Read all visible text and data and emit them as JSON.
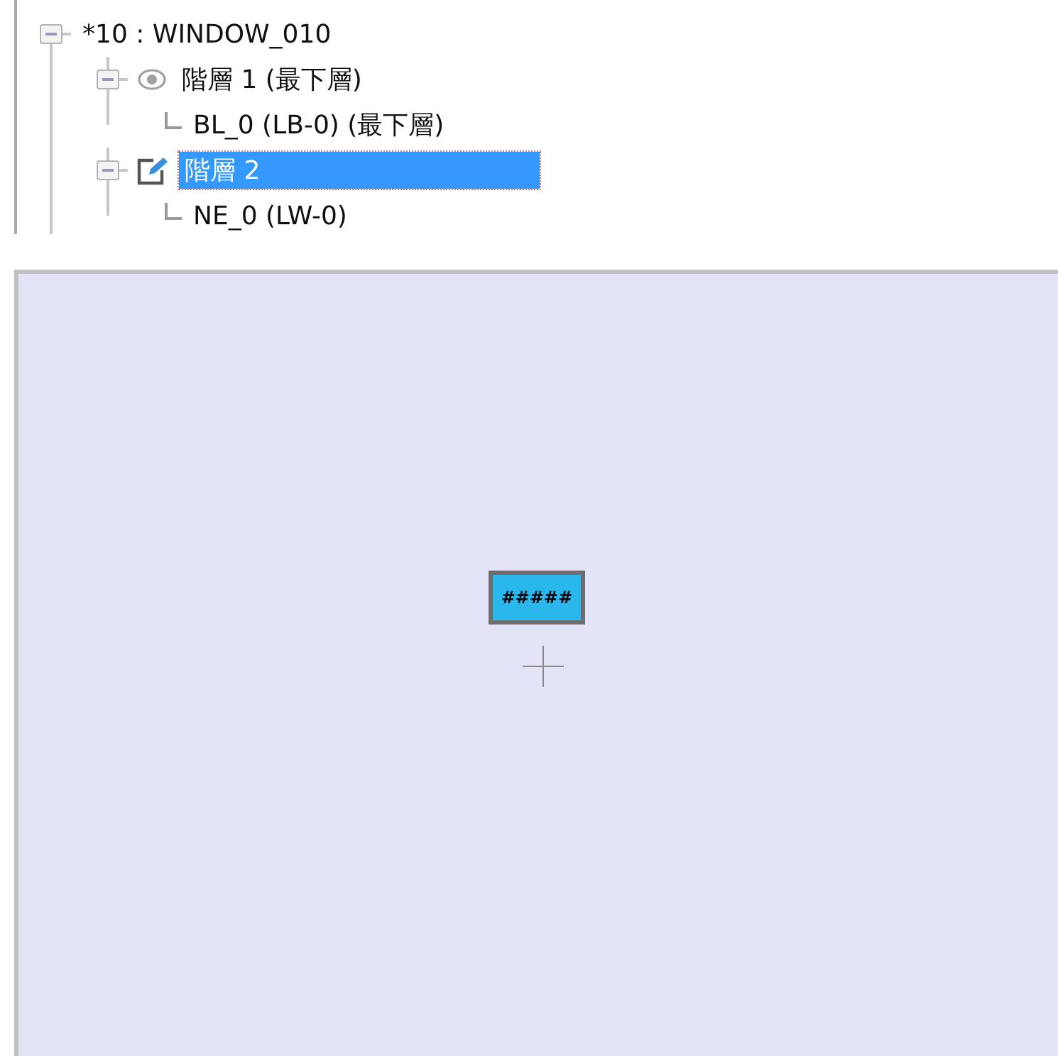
{
  "tree": {
    "label": "*10 : WINDOW_010",
    "expanded": true,
    "children": [
      {
        "label": "階層 1 (最下層)",
        "kind": "visible",
        "selected": false,
        "expanded": true,
        "children": [
          {
            "label": "BL_0 (LB-0) (最下層)"
          }
        ]
      },
      {
        "label": "階層 2",
        "kind": "editable",
        "selected": true,
        "expanded": true,
        "children": [
          {
            "label": "NE_0 (LW-0)"
          }
        ]
      }
    ]
  },
  "canvas": {
    "elements": [
      {
        "label": "#####"
      }
    ]
  }
}
